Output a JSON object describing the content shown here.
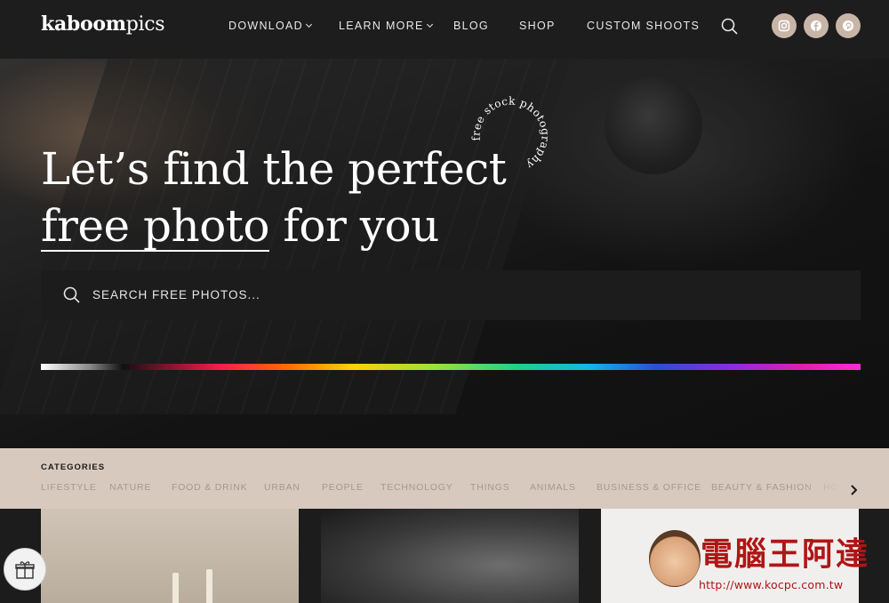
{
  "logo": {
    "bold": "kaboom",
    "light": "pics"
  },
  "nav": {
    "items": [
      {
        "label": "DOWNLOAD",
        "dropdown": true
      },
      {
        "label": "LEARN MORE",
        "dropdown": true
      },
      {
        "label": "BLOG",
        "dropdown": false
      },
      {
        "label": "SHOP",
        "dropdown": false
      },
      {
        "label": "CUSTOM SHOOTS",
        "dropdown": false
      }
    ],
    "social": [
      "instagram-icon",
      "facebook-icon",
      "pinterest-icon"
    ],
    "social_color": "#c9b5a8"
  },
  "hero": {
    "headline_line1": "Let’s find the perfect",
    "headline_underlined": "free photo",
    "headline_rest": " for you",
    "stamp_text": "free stock photography",
    "search_placeholder": "SEARCH FREE PHOTOS..."
  },
  "categories": {
    "title": "CATEGORIES",
    "items": [
      "LIFESTYLE",
      "NATURE",
      "FOOD & DRINK",
      "URBAN",
      "PEOPLE",
      "TECHNOLOGY",
      "THINGS",
      "ANIMALS",
      "BUSINESS & OFFICE",
      "BEAUTY & FASHION",
      "HO"
    ]
  },
  "watermark": {
    "name": "電腦王阿達",
    "url": "http://www.kocpc.com.tw"
  }
}
